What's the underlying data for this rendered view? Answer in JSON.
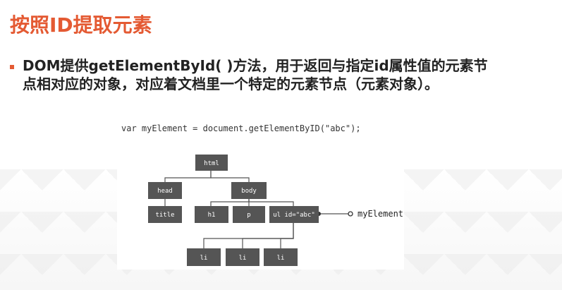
{
  "slide": {
    "title": "按照ID提取元素",
    "bullet_line1": "DOM提供getElementById( )方法，用于返回与指定id属性值的元素节",
    "bullet_line2": "点相对应的对象，对应着文档里一个特定的元素节点（元素对象）。",
    "code": "var myElement = document.getElementByID(\"abc\");"
  },
  "tree": {
    "html": "html",
    "head": "head",
    "body": "body",
    "title": "title",
    "h1": "h1",
    "p": "p",
    "ul": "ul id=\"abc\"",
    "li1": "li",
    "li2": "li",
    "li3": "li",
    "pointer_label": "myElement"
  },
  "colors": {
    "title": "#e45a33",
    "node": "#555555",
    "node_text": "#ffffff"
  }
}
